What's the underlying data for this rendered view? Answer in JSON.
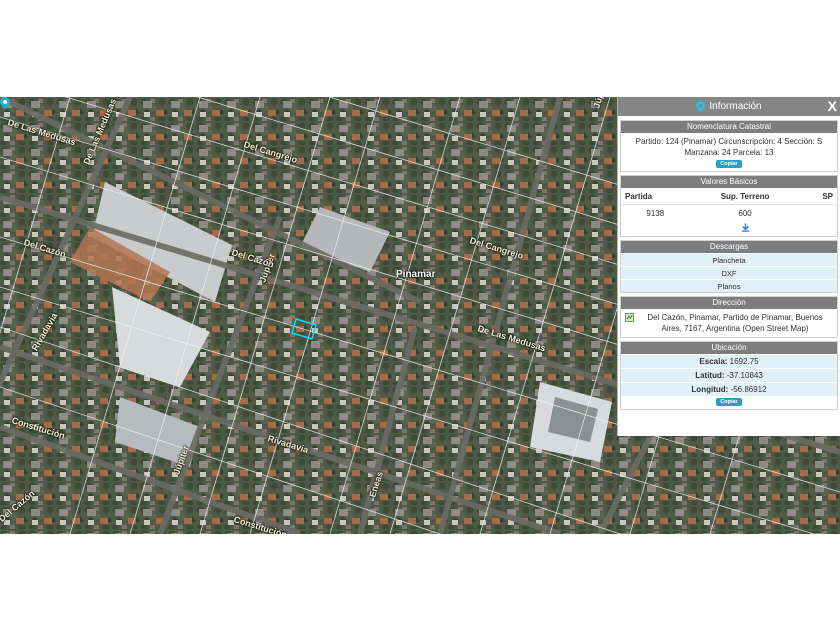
{
  "map": {
    "city_label": "Pinamar",
    "street_labels": [
      "De Las Medusas",
      "Del Cangrejo",
      "Del Cazón",
      "De Las Medusas",
      "Júpiter",
      "Del Cangrejo",
      "Rivadavia",
      "De Las Medusas",
      "Constitución",
      "Rivadavia",
      "Eneas",
      "Del Cazón",
      "Constitución",
      "Júpiter",
      "Del Cazón",
      "Júpiter"
    ]
  },
  "panel": {
    "title": "Información",
    "close_label": "X",
    "nomenclatura": {
      "title": "Nomenclatura Catastral",
      "line1": "Partido: 124 (Pinamar) Circunscripción: 4 Sección: S",
      "line2": "Manzana: 24 Parcela: 13",
      "copy_label": "Copiar"
    },
    "valores": {
      "title": "Valores Básicos",
      "headers": [
        "Partida",
        "Sup. Terreno",
        "SP"
      ],
      "row": [
        "9138",
        "600",
        ""
      ]
    },
    "descargas": {
      "title": "Descargas",
      "items": [
        "Plancheta",
        "DXF",
        "Planos"
      ]
    },
    "direccion": {
      "title": "Dirección",
      "text": "Del Cazón, Pinamar, Partido de Pinamar, Buenos Aires, 7167, Argentina (Open Street Map)"
    },
    "ubicacion": {
      "title": "Ubicación",
      "escala_label": "Escala:",
      "escala_value": "1692.75",
      "latitud_label": "Latitud:",
      "latitud_value": "-37.10843",
      "longitud_label": "Longitud:",
      "longitud_value": "-56.86912",
      "copy_label": "Copiar"
    }
  }
}
